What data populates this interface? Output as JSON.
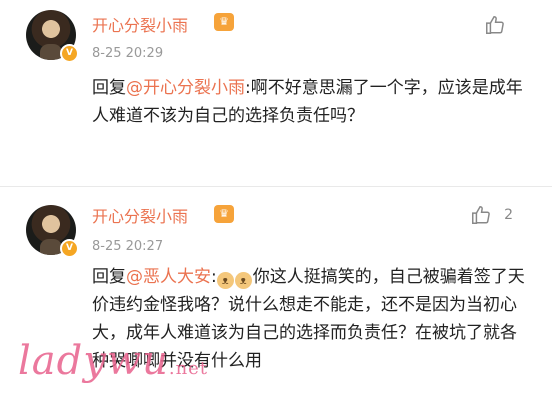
{
  "comments": [
    {
      "username": "开心分裂小雨",
      "time": "8-25 20:29",
      "like_count": "",
      "prefix": "回复",
      "mention": "@开心分裂小雨",
      "text": ":啊不好意思漏了一个字，应该是成年人难道不该为自己的选择负责任吗？"
    },
    {
      "username": "开心分裂小雨",
      "time": "8-25 20:27",
      "like_count": "2",
      "prefix": "回复",
      "mention": "@恶人大安",
      "text_a": ":",
      "text_b": "你这人挺搞笑的，自己被骗着签了天价违约金怪我咯？说什么想走不能走，还不是因为当初心大，成年人难道该为自己的选择而负责任？在被坑了就各种哭唧唧并没有什么用"
    }
  ],
  "icons": {
    "avatar": "avatar",
    "verified_badge": "verified-badge-icon",
    "member_crown": "crown-icon",
    "like": "thumbs-up-icon",
    "emoji": "cat-emoji-icon"
  },
  "watermark": {
    "main": "ladywu",
    "suffix": ".net"
  },
  "colors": {
    "username": "#eb7350",
    "mention": "#eb7350",
    "time": "#999999",
    "badge": "#f5a623",
    "watermark": "#e8608c"
  }
}
